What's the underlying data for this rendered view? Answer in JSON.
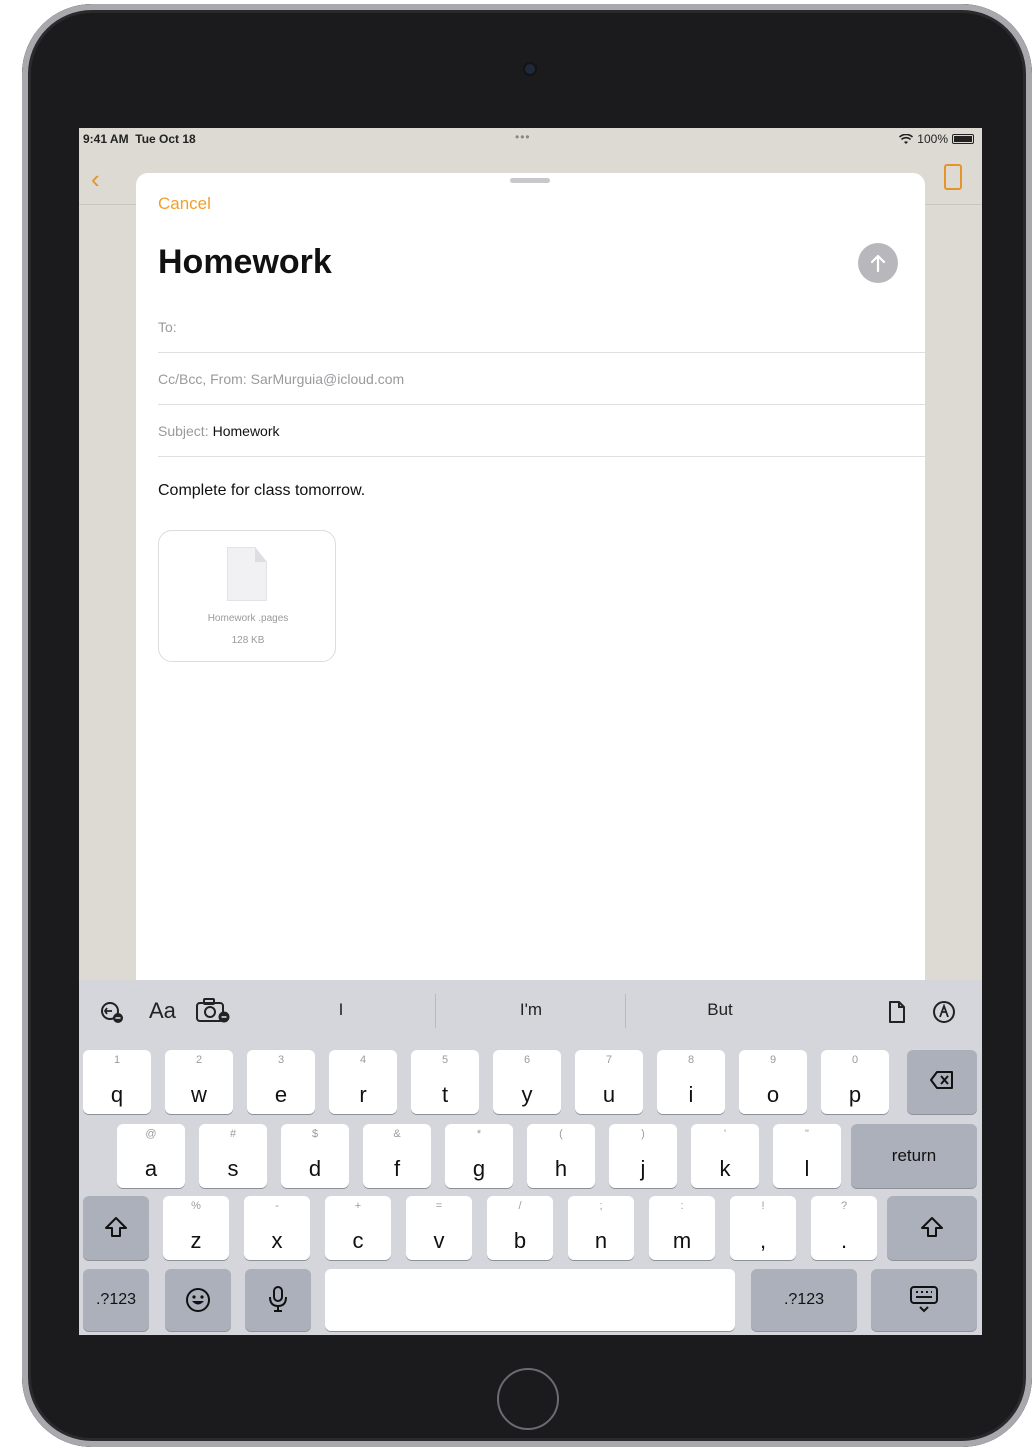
{
  "status": {
    "time": "9:41 AM",
    "date": "Tue Oct 18",
    "dots": "•••",
    "battery": "100%"
  },
  "compose": {
    "cancel": "Cancel",
    "title": "Homework",
    "to_label": "To:",
    "ccbcc_label": "Cc/Bcc, From:",
    "from_value": "SarMurguia@icloud.com",
    "subject_label": "Subject:",
    "subject_value": "Homework",
    "body": "Complete for class tomorrow.",
    "attachment": {
      "name": "Homework .pages",
      "size": "128 KB"
    }
  },
  "suggestions": [
    "I",
    "I'm",
    "But"
  ],
  "keyboard": {
    "row1": [
      {
        "k": "q",
        "a": "1"
      },
      {
        "k": "w",
        "a": "2"
      },
      {
        "k": "e",
        "a": "3"
      },
      {
        "k": "r",
        "a": "4"
      },
      {
        "k": "t",
        "a": "5"
      },
      {
        "k": "y",
        "a": "6"
      },
      {
        "k": "u",
        "a": "7"
      },
      {
        "k": "i",
        "a": "8"
      },
      {
        "k": "o",
        "a": "9"
      },
      {
        "k": "p",
        "a": "0"
      }
    ],
    "row2": [
      {
        "k": "a",
        "a": "@"
      },
      {
        "k": "s",
        "a": "#"
      },
      {
        "k": "d",
        "a": "$"
      },
      {
        "k": "f",
        "a": "&"
      },
      {
        "k": "g",
        "a": "*"
      },
      {
        "k": "h",
        "a": "("
      },
      {
        "k": "j",
        "a": ")"
      },
      {
        "k": "k",
        "a": "'"
      },
      {
        "k": "l",
        "a": "\""
      }
    ],
    "row3": [
      {
        "k": "z",
        "a": "%"
      },
      {
        "k": "x",
        "a": "-"
      },
      {
        "k": "c",
        "a": "+"
      },
      {
        "k": "v",
        "a": "="
      },
      {
        "k": "b",
        "a": "/"
      },
      {
        "k": "n",
        "a": ";"
      },
      {
        "k": "m",
        "a": ":"
      },
      {
        "k": ",",
        "a": "!"
      },
      {
        "k": ".",
        "a": "?"
      }
    ],
    "return_label": "return",
    "numbers_label": ".?123"
  },
  "icons": {
    "back": "chevron-left-icon",
    "send": "arrow-up-icon",
    "delete": "delete-backward-icon",
    "shift": "shift-icon",
    "emoji": "emoji-icon",
    "mic": "microphone-icon",
    "hide_keyboard": "keyboard-dismiss-icon",
    "scribble": "scribble-icon",
    "format": "Aa",
    "camera": "camera-icon",
    "file": "document-icon",
    "markup": "pencil-circle-icon"
  },
  "colors": {
    "accent": "#f0a030",
    "send_disabled": "#b8b8bc"
  }
}
